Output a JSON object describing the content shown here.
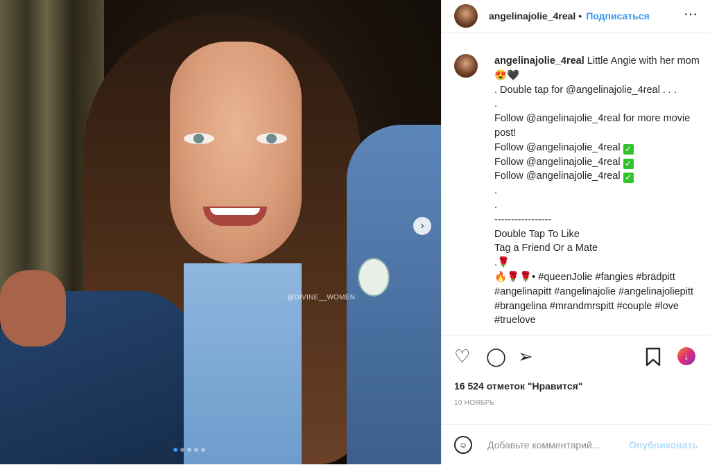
{
  "post": {
    "username": "angelinajolie_4real",
    "separator": "•",
    "follow_label": "Подписаться",
    "more_icon": "⋯",
    "watermark": "@DIVINE__WOMEN",
    "carousel_dots": 5
  },
  "caption": {
    "username": "angelinajolie_4real",
    "lines": [
      "Little Angie with her mom😍🖤",
      ". Double tap for @angelinajolie_4real . . .",
      ".",
      "Follow @angelinajolie_4real for more movie post!",
      "Follow @angelinajolie_4real",
      "Follow @angelinajolie_4real",
      "Follow @angelinajolie_4real",
      ".",
      ".",
      "-----------------",
      "Double Tap To Like",
      "Tag a Friend Or a Mate",
      ".🌹",
      "🔥🌹🌹• #queenJolie #fangies #bradpitt #angelinapitt #angelinajolie #angelinajoliepitt #brangelina #mrandmrspitt #couple #love #truelove"
    ]
  },
  "actions": {
    "heart_icon": "♡",
    "comment_icon": "◯",
    "share_icon": "➢",
    "save_icon": "🔖",
    "igtv_icon": "↓"
  },
  "likes_text": "16 524 отметок \"Нравится\"",
  "date_text": "10 НОЯБРЬ",
  "comment": {
    "placeholder": "Добавьте комментарий...",
    "post_label": "Опубликовать",
    "emoji_icon": "☺"
  },
  "colors": {
    "link": "#3897f0",
    "post_disabled": "#b2dffc",
    "check": "#31c32e"
  }
}
